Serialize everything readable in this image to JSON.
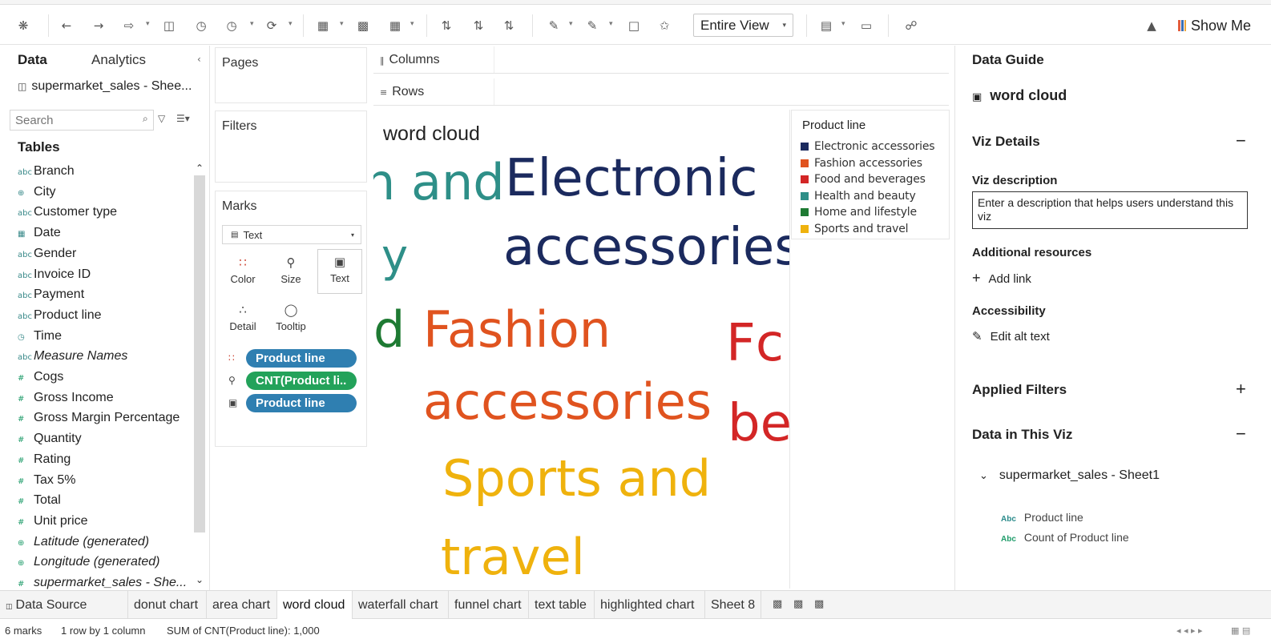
{
  "toolbar": {
    "view_select": "Entire View",
    "show_me": "Show Me"
  },
  "data_pane": {
    "tab_data": "Data",
    "tab_analytics": "Analytics",
    "datasource": "supermarket_sales - Shee...",
    "search_placeholder": "Search",
    "tables_header": "Tables",
    "fields": [
      {
        "label": "Branch",
        "kind": "dim",
        "icon": "Abc"
      },
      {
        "label": "City",
        "kind": "dim",
        "icon": "globe"
      },
      {
        "label": "Customer type",
        "kind": "dim",
        "icon": "Abc"
      },
      {
        "label": "Date",
        "kind": "dim",
        "icon": "calendar"
      },
      {
        "label": "Gender",
        "kind": "dim",
        "icon": "Abc"
      },
      {
        "label": "Invoice ID",
        "kind": "dim",
        "icon": "Abc"
      },
      {
        "label": "Payment",
        "kind": "dim",
        "icon": "Abc"
      },
      {
        "label": "Product line",
        "kind": "dim",
        "icon": "Abc"
      },
      {
        "label": "Time",
        "kind": "dim",
        "icon": "clock"
      },
      {
        "label": "Measure Names",
        "kind": "dim",
        "icon": "Abc",
        "italic": true
      },
      {
        "label": "Cogs",
        "kind": "measure",
        "icon": "#"
      },
      {
        "label": "Gross Income",
        "kind": "measure",
        "icon": "#"
      },
      {
        "label": "Gross Margin Percentage",
        "kind": "measure",
        "icon": "#"
      },
      {
        "label": "Quantity",
        "kind": "measure",
        "icon": "#"
      },
      {
        "label": "Rating",
        "kind": "measure",
        "icon": "#"
      },
      {
        "label": "Tax 5%",
        "kind": "measure",
        "icon": "#"
      },
      {
        "label": "Total",
        "kind": "measure",
        "icon": "#"
      },
      {
        "label": "Unit price",
        "kind": "measure",
        "icon": "#"
      },
      {
        "label": "Latitude (generated)",
        "kind": "measure",
        "icon": "globe",
        "italic": true
      },
      {
        "label": "Longitude (generated)",
        "kind": "measure",
        "icon": "globe",
        "italic": true
      },
      {
        "label": "supermarket_sales - She...",
        "kind": "measure",
        "icon": "#",
        "italic": true
      }
    ]
  },
  "shelves": {
    "pages": "Pages",
    "filters": "Filters",
    "marks": "Marks",
    "columns": "Columns",
    "rows": "Rows"
  },
  "marks": {
    "type": "Text",
    "buttons": {
      "color": "Color",
      "size": "Size",
      "text": "Text",
      "detail": "Detail",
      "tooltip": "Tooltip"
    },
    "pills": [
      {
        "label": "Product line",
        "type": "dim"
      },
      {
        "label": "CNT(Product li..",
        "type": "measure"
      },
      {
        "label": "Product line",
        "type": "dim"
      }
    ]
  },
  "viz": {
    "title": "word cloud",
    "words": [
      {
        "text": "Electronic",
        "color": "#1b2a5e",
        "category": "Electronic accessories"
      },
      {
        "text": "accessories",
        "color": "#1b2a5e",
        "category": "Electronic accessories"
      },
      {
        "text": "Fashion",
        "color": "#e0531f",
        "category": "Fashion accessories"
      },
      {
        "text": "accessories",
        "color": "#e0531f",
        "category": "Fashion accessories"
      },
      {
        "text": "Sports and",
        "color": "#efb20d",
        "category": "Sports and travel"
      },
      {
        "text": "travel",
        "color": "#efb20d",
        "category": "Sports and travel"
      },
      {
        "text": "h and",
        "color": "#2e8f88",
        "category": "Health and beauty"
      },
      {
        "text": "y",
        "color": "#2e8f88",
        "category": "Health and beauty"
      },
      {
        "text": "d",
        "color": "#1e7a33",
        "category": "Home and lifestyle"
      },
      {
        "text": "Fc",
        "color": "#d32626",
        "category": "Food and beverages"
      },
      {
        "text": "be",
        "color": "#d32626",
        "category": "Food and beverages"
      }
    ]
  },
  "legend": {
    "title": "Product line",
    "items": [
      {
        "label": "Electronic accessories",
        "color": "#1b2a5e"
      },
      {
        "label": "Fashion accessories",
        "color": "#e0531f"
      },
      {
        "label": "Food and beverages",
        "color": "#d32626"
      },
      {
        "label": "Health and beauty",
        "color": "#2e8f88"
      },
      {
        "label": "Home and lifestyle",
        "color": "#1e7a33"
      },
      {
        "label": "Sports and travel",
        "color": "#efb20d"
      }
    ]
  },
  "guide": {
    "title": "Data Guide",
    "sheet_name": "word cloud",
    "viz_details": "Viz Details",
    "viz_description_label": "Viz description",
    "viz_description_text": "Enter a description that helps users understand this viz",
    "additional_resources": "Additional resources",
    "add_link": "Add link",
    "accessibility": "Accessibility",
    "edit_alt_text": "Edit alt text",
    "applied_filters": "Applied Filters",
    "data_in_viz": "Data in This Viz",
    "datasource": "supermarket_sales - Sheet1",
    "fields": [
      "Product line",
      "Count of Product line"
    ],
    "field_type": "Abc",
    "collapse_symbol": "−",
    "expand_symbol": "+"
  },
  "tabs": {
    "data_source": "Data Source",
    "sheets": [
      "donut chart",
      "area chart",
      "word cloud",
      "waterfall chart",
      "funnel chart",
      "text table",
      "highlighted chart",
      "Sheet 8"
    ],
    "active_sheet": "word cloud"
  },
  "status": {
    "marks": "6 marks",
    "layout": "1 row by 1 column",
    "sum": "SUM of CNT(Product line): 1,000"
  }
}
